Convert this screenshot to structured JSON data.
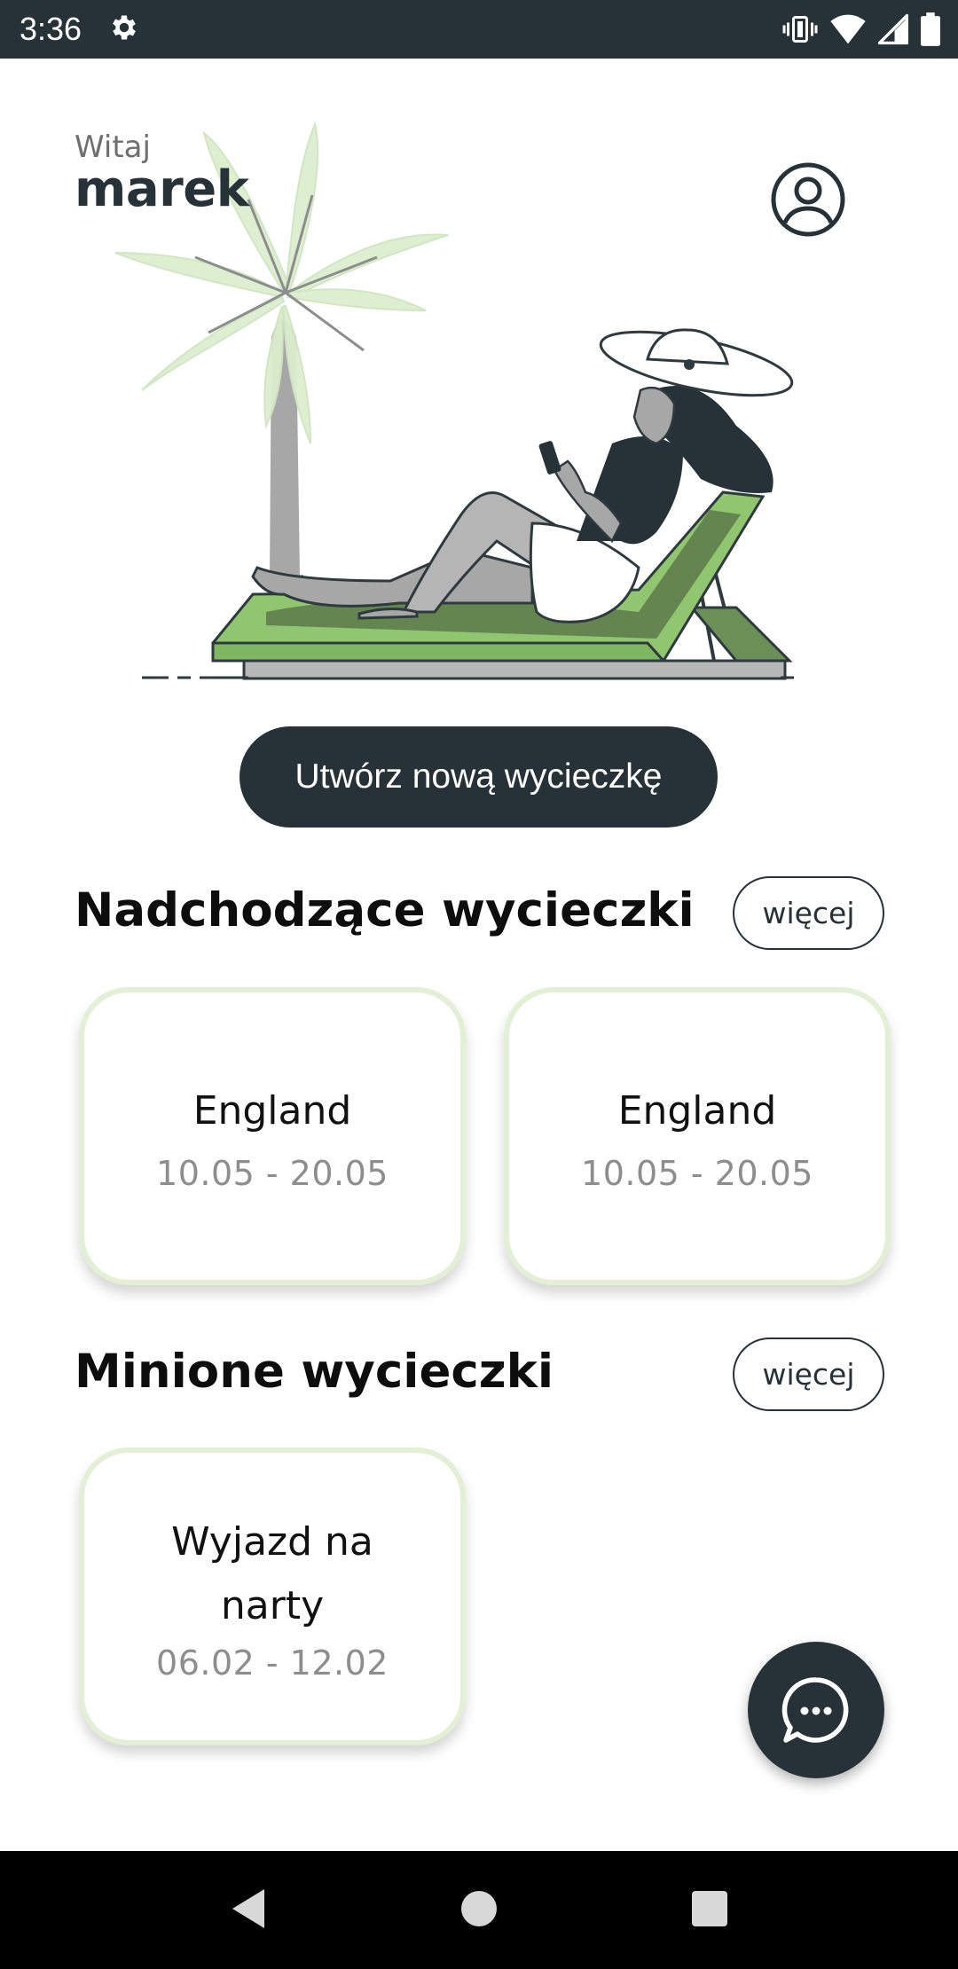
{
  "status_bar": {
    "time": "3:36",
    "icons": [
      "settings-icon",
      "vibrate-icon",
      "wifi-icon",
      "signal-icon",
      "battery-icon"
    ]
  },
  "greeting": {
    "label": "Witaj",
    "name": "marek"
  },
  "profile": {
    "icon": "account-circle-icon"
  },
  "create_trip_button": "Utwórz nową wycieczkę",
  "upcoming": {
    "title": "Nadchodzące wycieczki",
    "more_label": "więcej",
    "trips": [
      {
        "name": "England",
        "dates": "10.05 - 20.05"
      },
      {
        "name": "England",
        "dates": "10.05 - 20.05"
      }
    ]
  },
  "past": {
    "title": "Minione wycieczki",
    "more_label": "więcej",
    "trips": [
      {
        "name": "Wyjazd na narty",
        "dates": "06.02 - 12.02"
      }
    ]
  },
  "chat_button": {
    "icon": "chat-bubble-icon"
  },
  "nav_bar": {
    "icons": [
      "back-icon",
      "home-icon",
      "recents-icon"
    ]
  },
  "colors": {
    "primary": "#263238",
    "card_border": "#e3f0d6",
    "leaf_green": "#8fc66f",
    "date_gray": "#8d8d8d"
  }
}
